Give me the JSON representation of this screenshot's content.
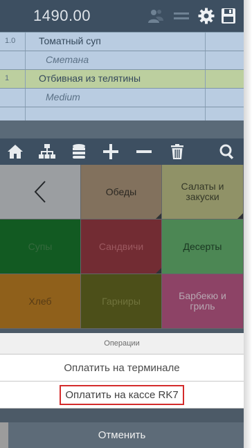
{
  "header": {
    "total": "1490.00",
    "icons": [
      "users-icon",
      "menu-icon",
      "gear-icon",
      "save-icon"
    ]
  },
  "order": {
    "rows": [
      {
        "qty": "1.0",
        "name": "Томатный суп",
        "type": "dish"
      },
      {
        "qty": "",
        "name": "Сметана",
        "type": "modifier"
      },
      {
        "qty": "1",
        "name": "Отбивная из телятины",
        "type": "dish"
      },
      {
        "qty": "",
        "name": "Medium",
        "type": "modifier"
      }
    ]
  },
  "toolbar": {
    "icons": [
      "home-icon",
      "hierarchy-icon",
      "database-icon",
      "plus-icon",
      "minus-icon",
      "trash-icon",
      "search-icon"
    ]
  },
  "menu": {
    "back_glyph": "<",
    "categories": [
      {
        "label": "",
        "color": "#c8c8c8",
        "back": true
      },
      {
        "label": "Обеды",
        "color": "#a58a6a"
      },
      {
        "label": "Салаты и закуски",
        "color": "#b9b878"
      },
      {
        "label": "Супы",
        "color": "#0b6a18"
      },
      {
        "label": "Сандвичи",
        "color": "#8f2a30"
      },
      {
        "label": "Десерты",
        "color": "#5aa85d"
      },
      {
        "label": "Хлеб",
        "color": "#b8720f"
      },
      {
        "label": "Гарниры",
        "color": "#5a5a0c"
      },
      {
        "label": "Барбекю и гриль",
        "color": "#b54a76"
      }
    ]
  },
  "sheet": {
    "title": "Операции",
    "pay_terminal": "Оплатить на терминале",
    "pay_cashier": "Оплатить на кассе RK7",
    "cancel": "Отменить"
  },
  "colors": {
    "header_bg": "#3d4f61",
    "highlight": "#d42b2b"
  }
}
